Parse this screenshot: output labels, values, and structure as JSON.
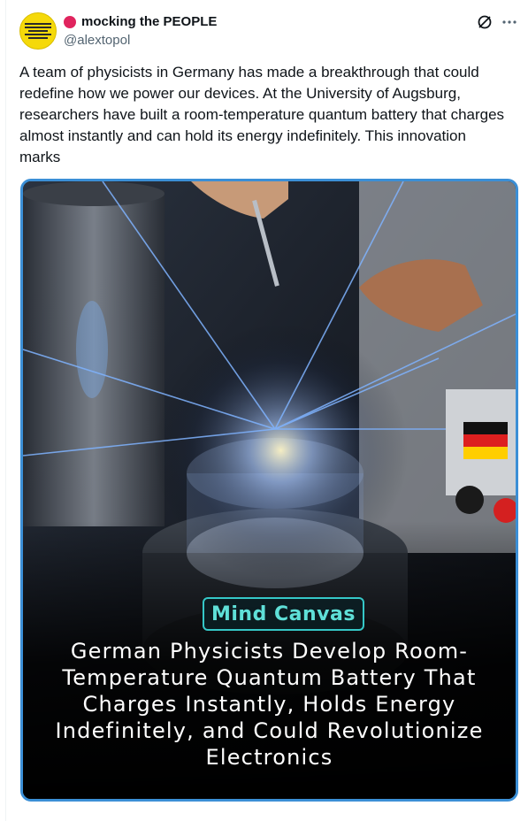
{
  "author": {
    "display_name": "mocking the PEOPLE",
    "handle": "@alextopol",
    "avatar_label": "WITHDRAWN CONSENT"
  },
  "tweet": {
    "text": "A team of physicists in Germany has made a breakthrough that could redefine how we power our devices. At the University of Augsburg, researchers have built a room-temperature quantum battery that charges almost instantly and can hold its energy indefinitely. This innovation marks"
  },
  "media": {
    "badge": "Mind Canvas",
    "headline": "German Physicists Develop Room-Temperature Quantum Battery That Charges Instantly, Holds Energy Indefinitely, and Could Revolutionize Electronics"
  },
  "icons": {
    "status": "stop-sign-icon",
    "grok": "grok-icon",
    "more": "more-icon"
  },
  "colors": {
    "text": "#0f1419",
    "secondary": "#536471",
    "media_border": "#3b8fd6",
    "badge": "#35c7c7"
  }
}
